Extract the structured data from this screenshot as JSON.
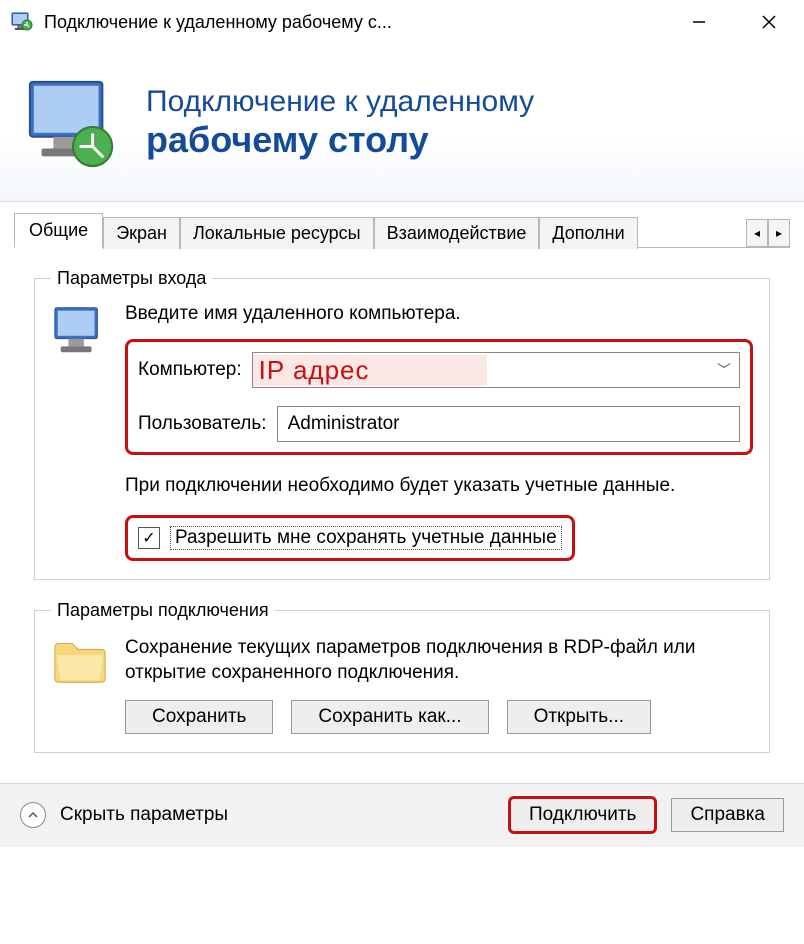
{
  "window": {
    "title": "Подключение к удаленному рабочему с..."
  },
  "banner": {
    "line1": "Подключение к удаленному",
    "line2": "рабочему столу"
  },
  "tabs": {
    "items": [
      "Общие",
      "Экран",
      "Локальные ресурсы",
      "Взаимодействие",
      "Дополни"
    ],
    "active": 0
  },
  "login": {
    "legend": "Параметры входа",
    "instruction": "Введите имя удаленного компьютера.",
    "computer_label": "Компьютер:",
    "computer_value": "IP адрес",
    "user_label": "Пользователь:",
    "user_value": "Administrator",
    "note": "При подключении необходимо будет указать учетные данные.",
    "save_creds_label": "Разрешить мне сохранять учетные данные",
    "save_creds_checked": true
  },
  "conn": {
    "legend": "Параметры подключения",
    "desc": "Сохранение текущих параметров подключения в RDP-файл или открытие сохраненного подключения.",
    "save": "Сохранить",
    "save_as": "Сохранить как...",
    "open": "Открыть..."
  },
  "footer": {
    "hide_label": "Скрыть параметры",
    "connect": "Подключить",
    "help": "Справка"
  }
}
